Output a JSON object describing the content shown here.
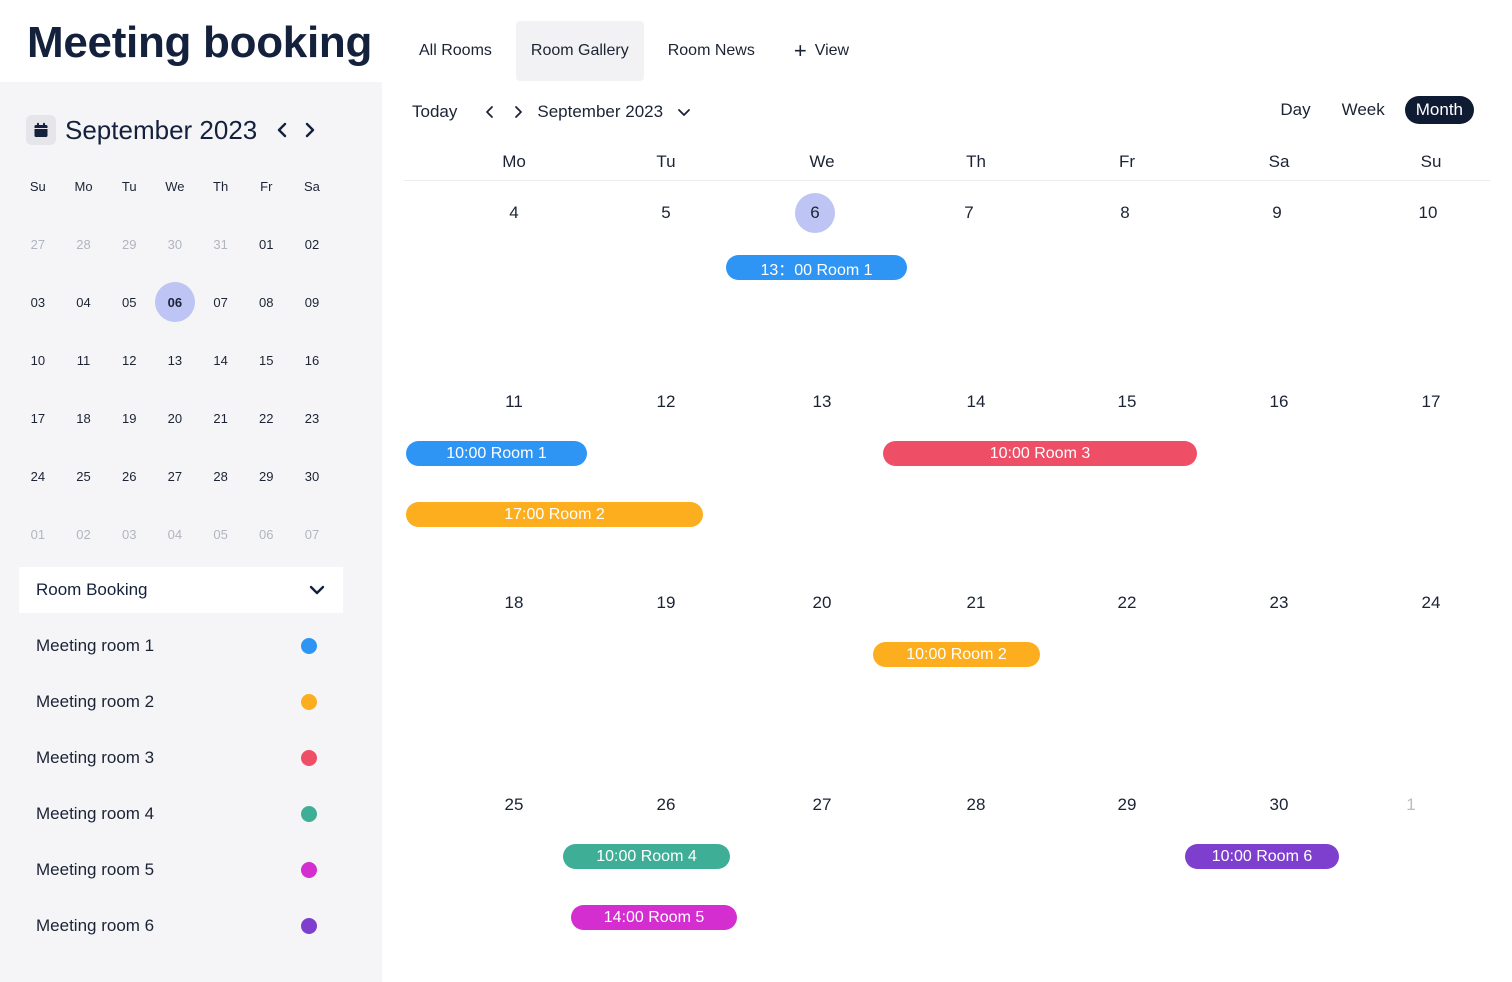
{
  "app": {
    "title": "Meeting booking"
  },
  "tabs": [
    {
      "label": "All Rooms"
    },
    {
      "label": "Room Gallery",
      "active": true
    },
    {
      "label": "Room News"
    },
    {
      "label": "View",
      "icon": "plus-icon"
    }
  ],
  "mini_calendar": {
    "month_label": "September 2023",
    "icon": "calendar-icon",
    "weekdays": [
      "Su",
      "Mo",
      "Tu",
      "We",
      "Th",
      "Fr",
      "Sa"
    ],
    "days": [
      {
        "d": "27",
        "muted": true
      },
      {
        "d": "28",
        "muted": true
      },
      {
        "d": "29",
        "muted": true
      },
      {
        "d": "30",
        "muted": true
      },
      {
        "d": "31",
        "muted": true
      },
      {
        "d": "01"
      },
      {
        "d": "02"
      },
      {
        "d": "03"
      },
      {
        "d": "04"
      },
      {
        "d": "05"
      },
      {
        "d": "06",
        "today": true
      },
      {
        "d": "07"
      },
      {
        "d": "08"
      },
      {
        "d": "09"
      },
      {
        "d": "10"
      },
      {
        "d": "11"
      },
      {
        "d": "12"
      },
      {
        "d": "13"
      },
      {
        "d": "14"
      },
      {
        "d": "15"
      },
      {
        "d": "16"
      },
      {
        "d": "17"
      },
      {
        "d": "18"
      },
      {
        "d": "19"
      },
      {
        "d": "20"
      },
      {
        "d": "21"
      },
      {
        "d": "22"
      },
      {
        "d": "23"
      },
      {
        "d": "24"
      },
      {
        "d": "25"
      },
      {
        "d": "26"
      },
      {
        "d": "27"
      },
      {
        "d": "28"
      },
      {
        "d": "29"
      },
      {
        "d": "30"
      },
      {
        "d": "01",
        "muted": true
      },
      {
        "d": "02",
        "muted": true
      },
      {
        "d": "03",
        "muted": true
      },
      {
        "d": "04",
        "muted": true
      },
      {
        "d": "05",
        "muted": true
      },
      {
        "d": "06",
        "muted": true
      },
      {
        "d": "07",
        "muted": true
      }
    ]
  },
  "room_booking": {
    "title": "Room Booking",
    "rooms": [
      {
        "name": "Meeting room 1",
        "color": "#2f95f5"
      },
      {
        "name": "Meeting room 2",
        "color": "#fdae1e"
      },
      {
        "name": "Meeting room 3",
        "color": "#ee4e66"
      },
      {
        "name": "Meeting room 4",
        "color": "#3fae97"
      },
      {
        "name": "Meeting room 5",
        "color": "#d42ed0"
      },
      {
        "name": "Meeting room 6",
        "color": "#7e3fcf"
      }
    ]
  },
  "toolbar": {
    "today_label": "Today",
    "month_label": "September 2023",
    "views": [
      {
        "label": "Day"
      },
      {
        "label": "Week"
      },
      {
        "label": "Month",
        "active": true
      }
    ]
  },
  "month_view": {
    "weekdays": [
      "Mo",
      "Tu",
      "We",
      "Th",
      "Fr",
      "Sa",
      "Su"
    ],
    "weeks": [
      [
        "4",
        "5",
        "6",
        "7",
        "8",
        "9",
        "10"
      ],
      [
        "11",
        "12",
        "13",
        "14",
        "15",
        "16",
        "17"
      ],
      [
        "18",
        "19",
        "20",
        "21",
        "22",
        "23",
        "24"
      ],
      [
        "25",
        "26",
        "27",
        "28",
        "29",
        "30",
        "1"
      ]
    ],
    "today": "6",
    "next_month_days": [
      "1"
    ],
    "events": [
      {
        "label": "13：00 Room 1",
        "color": "#2f95f5",
        "room": "Meeting room 1",
        "date": "2023-09-06"
      },
      {
        "label": "10:00 Room 1",
        "color": "#2f95f5",
        "room": "Meeting room 1",
        "date": "2023-09-11"
      },
      {
        "label": "10:00 Room 3",
        "color": "#ee4e66",
        "room": "Meeting room 3",
        "date": "2023-09-14"
      },
      {
        "label": "17:00 Room 2",
        "color": "#fdae1e",
        "room": "Meeting room 2",
        "date": "2023-09-11"
      },
      {
        "label": "10:00 Room 2",
        "color": "#fdae1e",
        "room": "Meeting room 2",
        "date": "2023-09-21"
      },
      {
        "label": "10:00 Room 4",
        "color": "#3fae97",
        "room": "Meeting room 4",
        "date": "2023-09-26"
      },
      {
        "label": "10:00 Room 6",
        "color": "#7e3fcf",
        "room": "Meeting room 6",
        "date": "2023-09-30"
      },
      {
        "label": "14:00 Room 5",
        "color": "#d42ed0",
        "room": "Meeting room 5",
        "date": "2023-09-26"
      }
    ]
  }
}
